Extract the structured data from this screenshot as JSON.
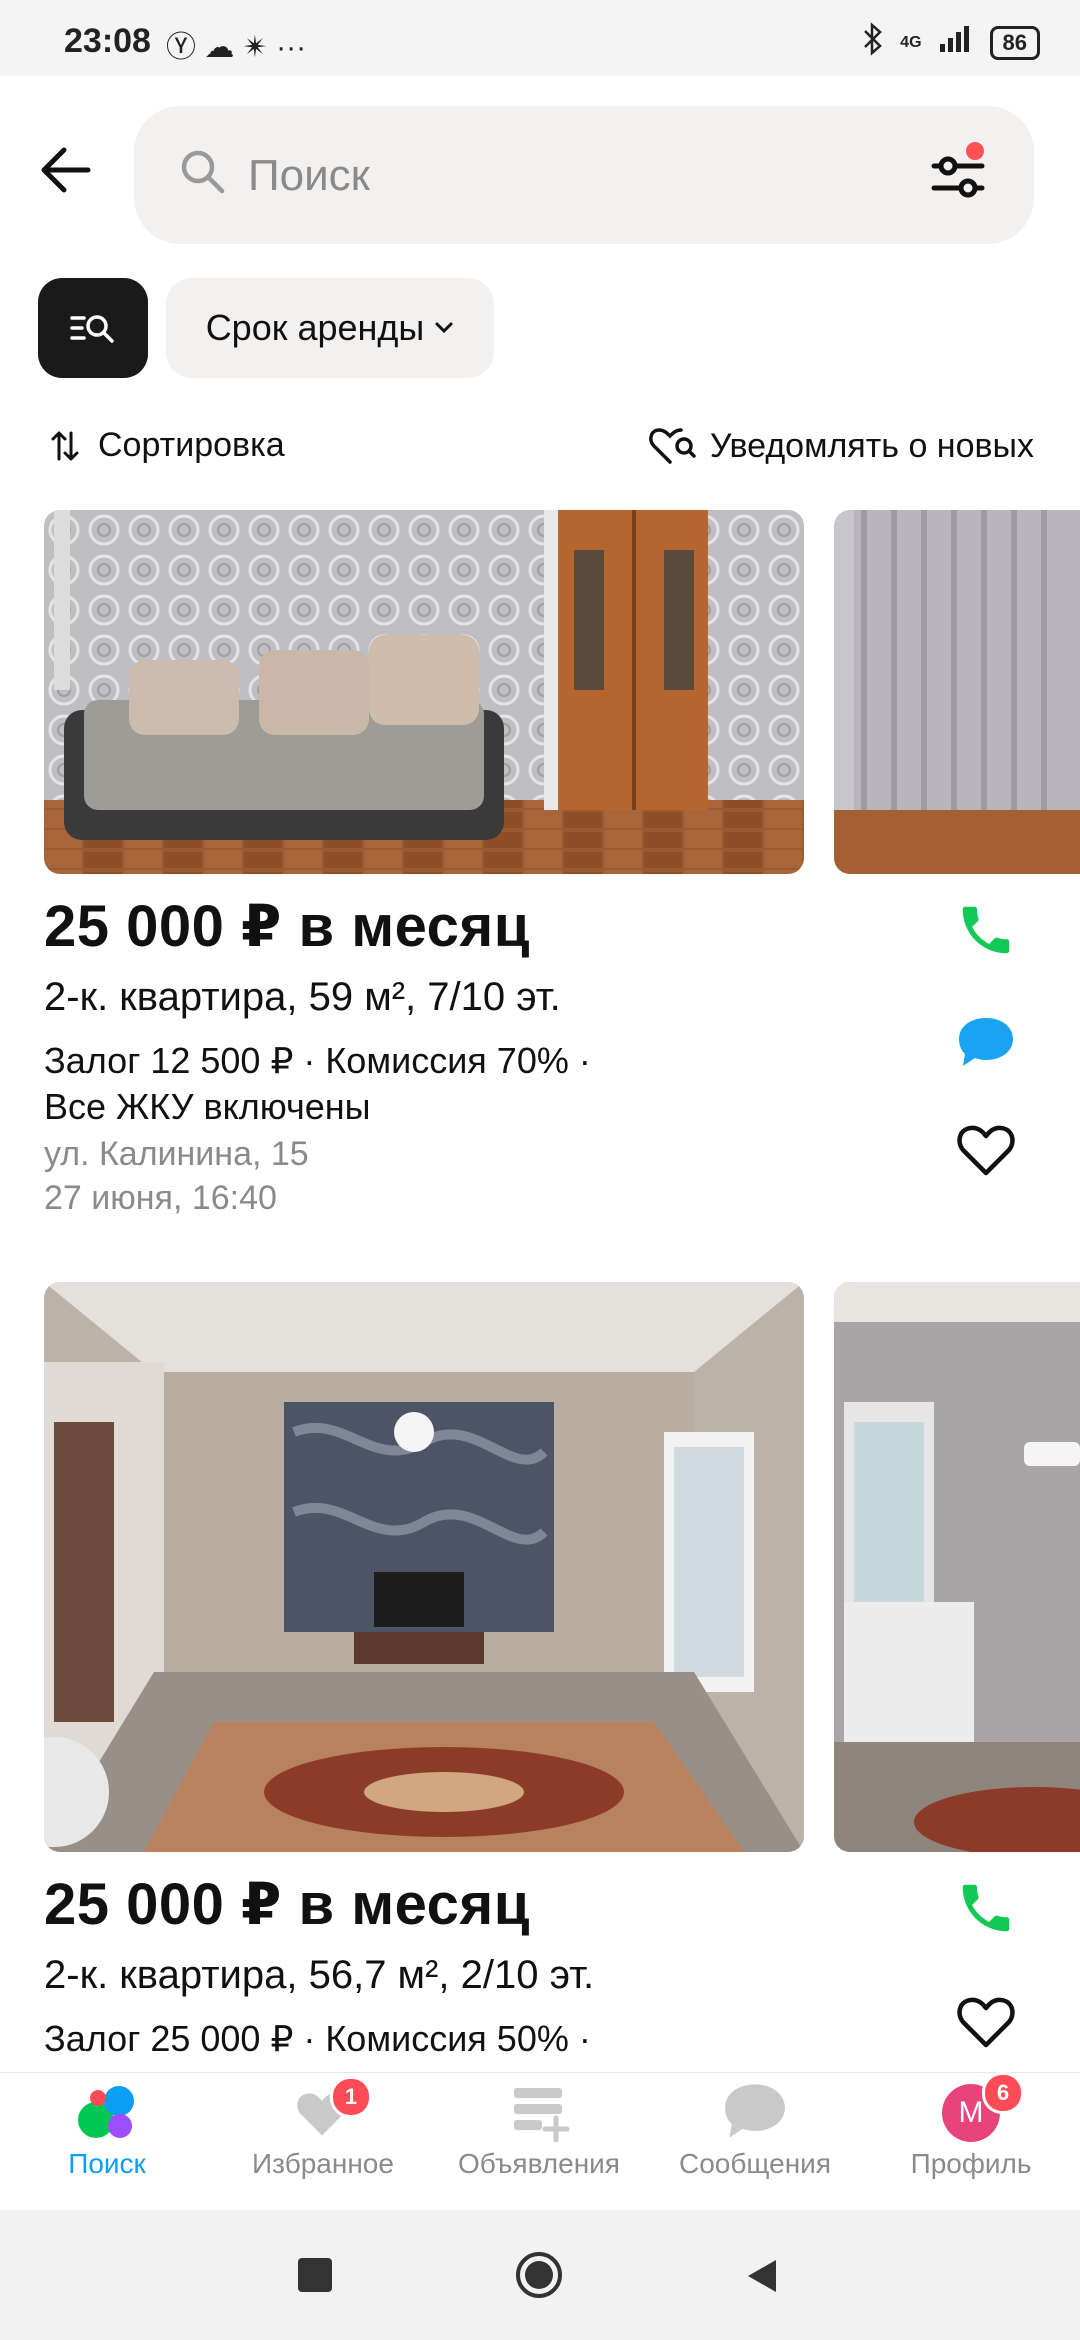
{
  "status_bar": {
    "time": "23:08",
    "left_icons": "Ⓨ ☁ ✴ ···",
    "network": "4G",
    "battery": "86"
  },
  "search": {
    "placeholder": "Поиск"
  },
  "chips": {
    "rent_term": "Срок аренды"
  },
  "sort_row": {
    "sort_label": "Сортировка",
    "notify_label": "Уведомлять о новых"
  },
  "listings": [
    {
      "price": "25 000 ₽ в месяц",
      "title": "2-к. квартира, 59 м², 7/10 эт.",
      "terms": "Залог 12 500 ₽ · Комиссия 70% · Все ЖКУ включены",
      "address": "ул. Калинина, 15",
      "date": "27 июня, 16:40"
    },
    {
      "price": "25 000 ₽ в месяц",
      "title": "2-к. квартира, 56,7 м², 2/10 эт.",
      "terms": "Залог 25 000 ₽ · Комиссия 50% ·"
    }
  ],
  "bottom_nav": [
    {
      "label": "Поиск"
    },
    {
      "label": "Избранное",
      "badge": "1"
    },
    {
      "label": "Объявления"
    },
    {
      "label": "Сообщения"
    },
    {
      "label": "Профиль",
      "badge": "6",
      "avatar_letter": "М"
    }
  ],
  "colors": {
    "accent": "#0a9ef7",
    "call_green": "#12c955",
    "chat_blue": "#1aa3f2",
    "badge_red": "#ff4b55"
  }
}
